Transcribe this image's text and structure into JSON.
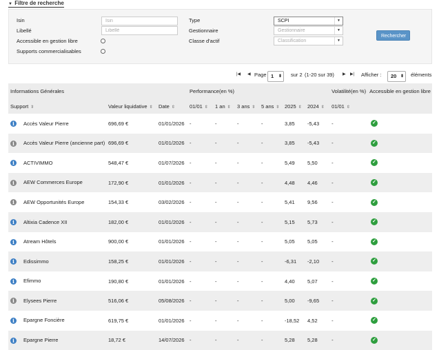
{
  "filter": {
    "title": "Filtre de recherche",
    "isin_label": "Isin",
    "isin_placeholder": "Isin",
    "libelle_label": "Libellé",
    "libelle_placeholder": "Libellé",
    "gestion_libre_label": "Accessible en gestion libre",
    "supports_label": "Supports commercialisables",
    "type_label": "Type",
    "type_value": "SCPI",
    "gestionnaire_label": "Gestionnaire",
    "gestionnaire_placeholder": "Gestionnaire",
    "classe_label": "Classe d'actif",
    "classe_placeholder": "Classification",
    "search_button": "Rechercher"
  },
  "pagination": {
    "page_label": "Page",
    "current_page": "1",
    "total_text": "sur 2",
    "range_text": "(1-20 sur 39)",
    "afficher_label": "Afficher :",
    "per_page": "20",
    "elements_label": "éléments"
  },
  "table": {
    "group_headers": {
      "general": "Informations Générales",
      "performance": "Performance(en %)",
      "volatilite": "Volatilité(en %)",
      "accessible": "Accessible en gestion libre"
    },
    "columns": {
      "support": "Support",
      "valeur": "Valeur liquidative",
      "date": "Date",
      "p0101": "01/01",
      "p1an": "1 an",
      "p3ans": "3 ans",
      "p5ans": "5 ans",
      "p2025": "2025",
      "p2024": "2024",
      "v0101": "01/01"
    },
    "rows": [
      {
        "icon_color": "#3d7fc4",
        "support": "Accès Valeur Pierre",
        "valeur": "696,69 €",
        "date": "01/01/2026",
        "p0101": "-",
        "p1an": "-",
        "p3ans": "-",
        "p5ans": "-",
        "p2025": "3,85",
        "p2024": "-5,43",
        "v0101": "-"
      },
      {
        "icon_color": "#888888",
        "support": "Accès Valeur Pierre (ancienne part)",
        "valeur": "696,69 €",
        "date": "01/01/2026",
        "p0101": "-",
        "p1an": "-",
        "p3ans": "-",
        "p5ans": "-",
        "p2025": "3,85",
        "p2024": "-5,43",
        "v0101": "-"
      },
      {
        "icon_color": "#3d7fc4",
        "support": "ACTIVIMMO",
        "valeur": "548,47 €",
        "date": "01/07/2026",
        "p0101": "-",
        "p1an": "-",
        "p3ans": "-",
        "p5ans": "-",
        "p2025": "5,49",
        "p2024": "5,50",
        "v0101": "-"
      },
      {
        "icon_color": "#888888",
        "support": "AEW Commerces Europe",
        "valeur": "172,90 €",
        "date": "01/01/2026",
        "p0101": "-",
        "p1an": "-",
        "p3ans": "-",
        "p5ans": "-",
        "p2025": "4,48",
        "p2024": "4,46",
        "v0101": "-"
      },
      {
        "icon_color": "#888888",
        "support": "AEW Opportunités Europe",
        "valeur": "154,33 €",
        "date": "03/02/2026",
        "p0101": "-",
        "p1an": "-",
        "p3ans": "-",
        "p5ans": "-",
        "p2025": "5,41",
        "p2024": "9,56",
        "v0101": "-"
      },
      {
        "icon_color": "#3d7fc4",
        "support": "Altixia Cadence XII",
        "valeur": "182,00 €",
        "date": "01/01/2026",
        "p0101": "-",
        "p1an": "-",
        "p3ans": "-",
        "p5ans": "-",
        "p2025": "5,15",
        "p2024": "5,73",
        "v0101": "-"
      },
      {
        "icon_color": "#3d7fc4",
        "support": "Atream Hôtels",
        "valeur": "900,00 €",
        "date": "01/01/2026",
        "p0101": "-",
        "p1an": "-",
        "p3ans": "-",
        "p5ans": "-",
        "p2025": "5,05",
        "p2024": "5,05",
        "v0101": "-"
      },
      {
        "icon_color": "#3d7fc4",
        "support": "Edissimmo",
        "valeur": "158,25 €",
        "date": "01/01/2026",
        "p0101": "-",
        "p1an": "-",
        "p3ans": "-",
        "p5ans": "-",
        "p2025": "-6,31",
        "p2024": "-2,10",
        "v0101": "-"
      },
      {
        "icon_color": "#3d7fc4",
        "support": "Efimmo",
        "valeur": "190,80 €",
        "date": "01/01/2026",
        "p0101": "-",
        "p1an": "-",
        "p3ans": "-",
        "p5ans": "-",
        "p2025": "4,40",
        "p2024": "5,07",
        "v0101": "-"
      },
      {
        "icon_color": "#888888",
        "support": "Elysees Pierre",
        "valeur": "516,06 €",
        "date": "05/08/2026",
        "p0101": "-",
        "p1an": "-",
        "p3ans": "-",
        "p5ans": "-",
        "p2025": "5,00",
        "p2024": "-9,65",
        "v0101": "-"
      },
      {
        "icon_color": "#3d7fc4",
        "support": "Epargne Foncière",
        "valeur": "619,75 €",
        "date": "01/01/2026",
        "p0101": "-",
        "p1an": "-",
        "p3ans": "-",
        "p5ans": "-",
        "p2025": "-18,52",
        "p2024": "4,52",
        "v0101": "-"
      },
      {
        "icon_color": "#3d7fc4",
        "support": "Epargne Pierre",
        "valeur": "18,72 €",
        "date": "14/07/2026",
        "p0101": "-",
        "p1an": "-",
        "p3ans": "-",
        "p5ans": "-",
        "p2025": "5,28",
        "p2024": "5,28",
        "v0101": "-"
      }
    ]
  }
}
